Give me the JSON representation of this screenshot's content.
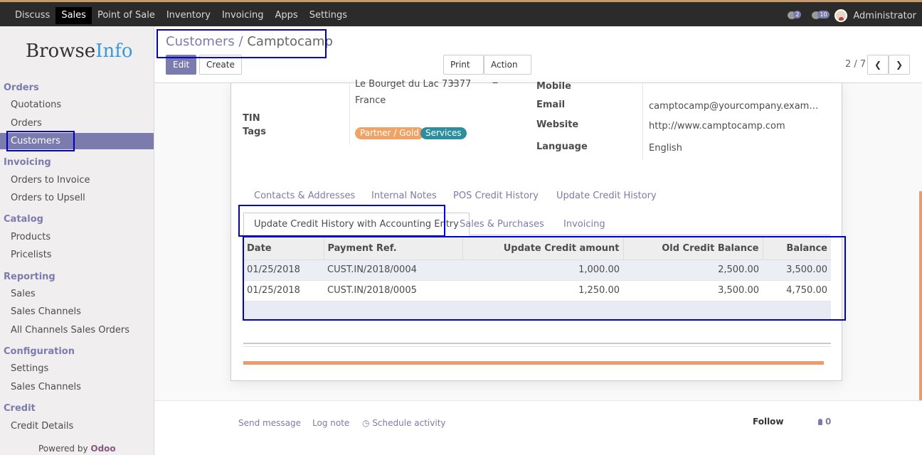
{
  "topbar": {
    "menu": [
      "Discuss",
      "Sales",
      "Point of Sale",
      "Inventory",
      "Invoicing",
      "Apps",
      "Settings"
    ],
    "active": "Sales",
    "activity_count": "2",
    "message_count": "10",
    "user": "Administrator"
  },
  "sidebar": {
    "logo_part1": "Browse",
    "logo_part2": "Info",
    "sections": [
      {
        "title": "Orders",
        "items": [
          "Quotations",
          "Orders",
          "Customers"
        ]
      },
      {
        "title": "Invoicing",
        "items": [
          "Orders to Invoice",
          "Orders to Upsell"
        ]
      },
      {
        "title": "Catalog",
        "items": [
          "Products",
          "Pricelists"
        ]
      },
      {
        "title": "Reporting",
        "items": [
          "Sales",
          "Sales Channels",
          "All Channels Sales Orders"
        ]
      },
      {
        "title": "Configuration",
        "items": [
          "Settings",
          "Sales Channels"
        ]
      },
      {
        "title": "Credit",
        "items": [
          "Credit Details"
        ]
      }
    ],
    "powered_by": "Powered by",
    "powered_brand": "Odoo"
  },
  "control_panel": {
    "breadcrumb_parent": "Customers",
    "breadcrumb_sep": "/",
    "breadcrumb_current": "Camptocamp",
    "edit_label": "Edit",
    "create_label": "Create",
    "print_label": "Print",
    "action_label": "Action",
    "pager": "2 / 7"
  },
  "form": {
    "address_line": "Le Bourget du Lac 73377",
    "country": "France",
    "tin_label": "TIN",
    "tags_label": "Tags",
    "tags": [
      {
        "label": "Partner / Gold",
        "color": "#f0a366"
      },
      {
        "label": "Services",
        "color": "#2d8f9e"
      }
    ],
    "mobile_label": "Mobile",
    "email_label": "Email",
    "email": "camptocamp@yourcompany.exam…",
    "website_label": "Website",
    "website": "http://www.camptocamp.com",
    "language_label": "Language",
    "language": "English"
  },
  "tabs_row1": [
    "Contacts & Addresses",
    "Internal Notes",
    "POS Credit History",
    "Update Credit History"
  ],
  "tabs_row2": [
    "Update Credit History with Accounting Entry",
    "Sales & Purchases",
    "Invoicing"
  ],
  "table": {
    "headers": [
      "Date",
      "Payment Ref.",
      "Update Credit amount",
      "Old Credit Balance",
      "Balance"
    ],
    "rows": [
      [
        "01/25/2018",
        "CUST.IN/2018/0004",
        "1,000.00",
        "2,500.00",
        "3,500.00"
      ],
      [
        "01/25/2018",
        "CUST.IN/2018/0005",
        "1,250.00",
        "3,500.00",
        "4,750.00"
      ]
    ]
  },
  "chatter": {
    "send_message": "Send message",
    "log_note": "Log note",
    "schedule_activity": "Schedule activity",
    "follow": "Follow",
    "followers": "0"
  }
}
